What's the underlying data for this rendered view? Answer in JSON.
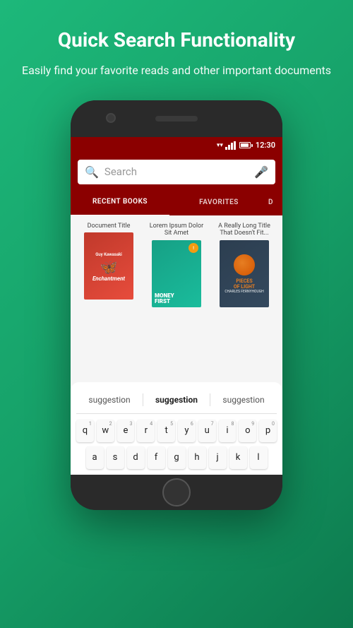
{
  "header": {
    "title": "Quick Search Functionality",
    "subtitle": "Easily find your favorite reads and other important documents"
  },
  "status_bar": {
    "time": "12:30"
  },
  "search": {
    "placeholder": "Search"
  },
  "tabs": [
    {
      "label": "RECENT BOOKS",
      "active": true
    },
    {
      "label": "FAVORITES",
      "active": false
    },
    {
      "label": "D",
      "partial": true
    }
  ],
  "books": [
    {
      "title": "Document Title",
      "author": "Guy Kawasaki",
      "cover_name": "Enchantment"
    },
    {
      "title": "Lorem Ipsum Dolor Sit Amet",
      "cover_name": "Money First"
    },
    {
      "title": "A Really Long Title That Doesn't Fit...",
      "cover_name": "Pieces of Light"
    }
  ],
  "suggestions": [
    {
      "label": "suggestion",
      "bold": false
    },
    {
      "label": "suggestion",
      "bold": true
    },
    {
      "label": "suggestion",
      "bold": false
    }
  ],
  "keyboard": {
    "row1": [
      {
        "letter": "q",
        "number": "1"
      },
      {
        "letter": "w",
        "number": "2"
      },
      {
        "letter": "e",
        "number": "3"
      },
      {
        "letter": "r",
        "number": "4"
      },
      {
        "letter": "t",
        "number": "5"
      },
      {
        "letter": "y",
        "number": "6"
      },
      {
        "letter": "u",
        "number": "7"
      },
      {
        "letter": "i",
        "number": "8"
      },
      {
        "letter": "o",
        "number": "9"
      },
      {
        "letter": "p",
        "number": "0"
      }
    ],
    "row2": [
      {
        "letter": "a"
      },
      {
        "letter": "s"
      },
      {
        "letter": "d"
      },
      {
        "letter": "f"
      },
      {
        "letter": "g"
      },
      {
        "letter": "h"
      },
      {
        "letter": "j"
      },
      {
        "letter": "k"
      },
      {
        "letter": "l"
      }
    ]
  }
}
